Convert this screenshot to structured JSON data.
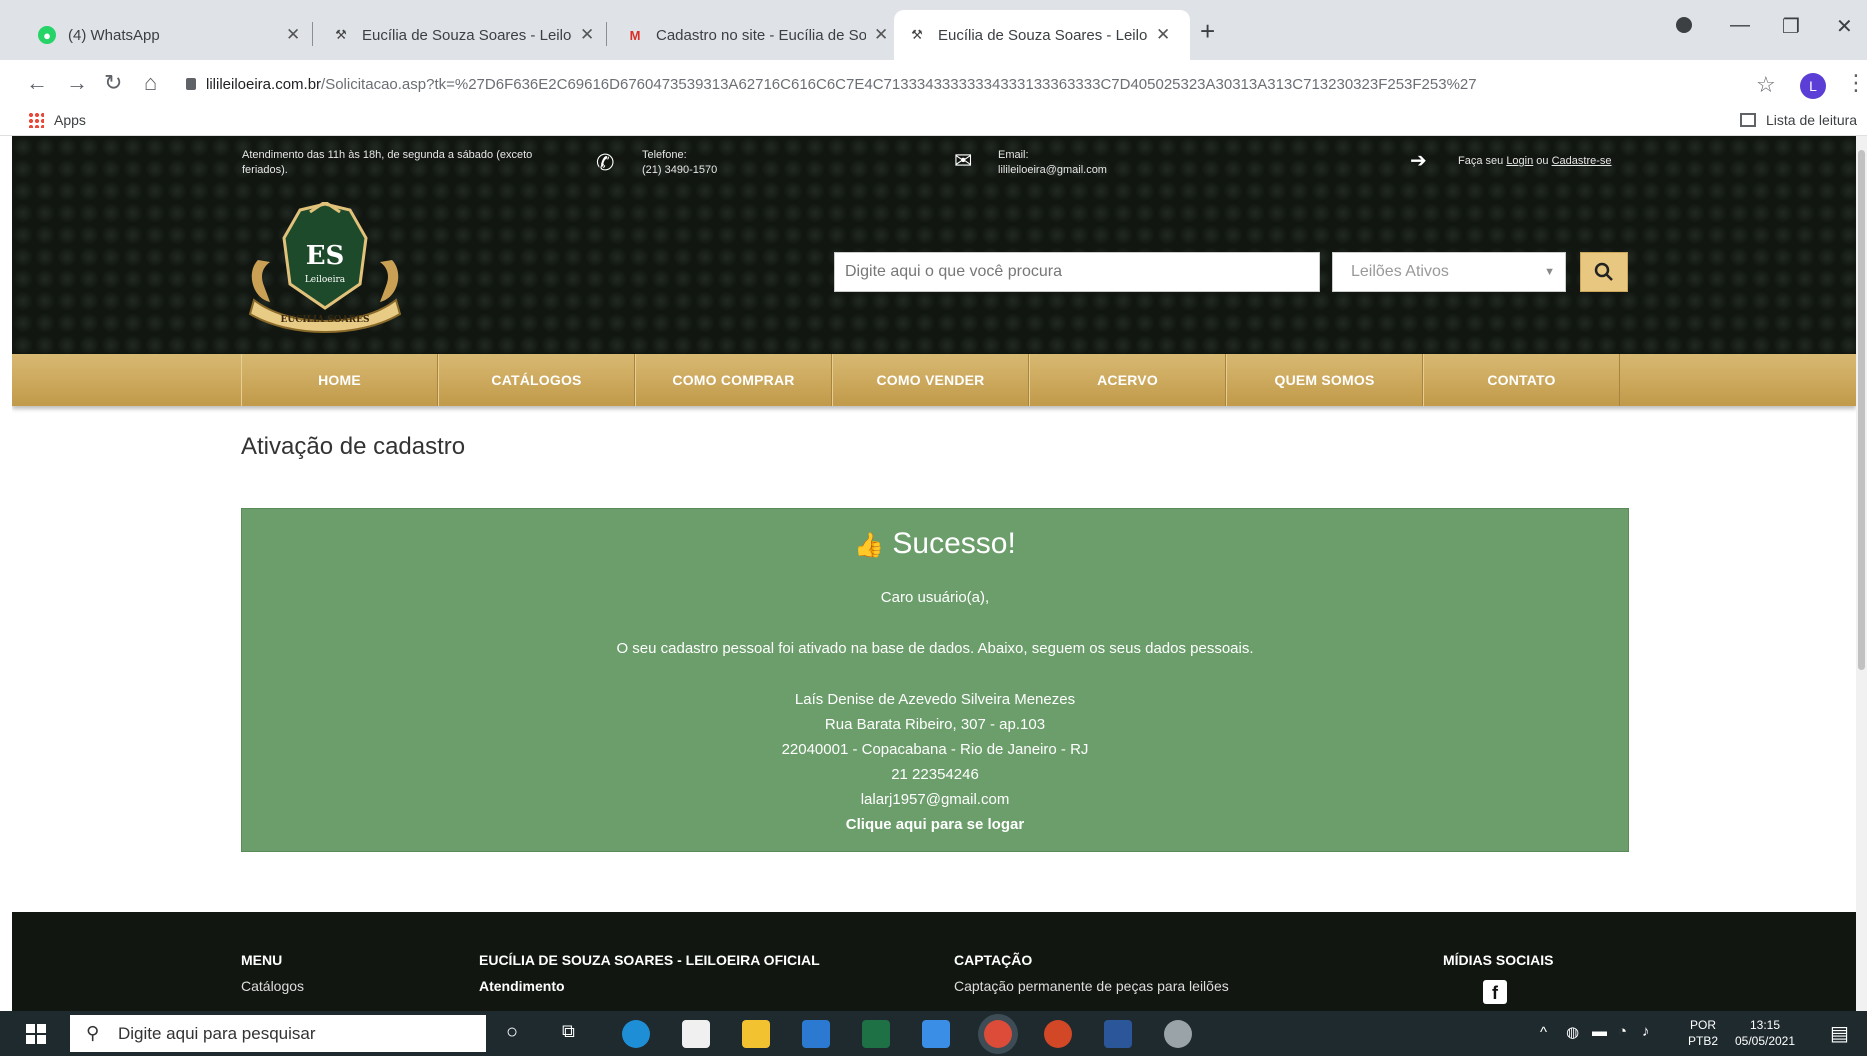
{
  "browser": {
    "tabs": [
      {
        "title": "(4) WhatsApp",
        "icon": "whatsapp-icon",
        "active": false
      },
      {
        "title": "Eucília de Souza Soares - Leiloei",
        "icon": "gavel-icon",
        "active": false
      },
      {
        "title": "Cadastro no site - Eucília de Sou",
        "icon": "gmail-icon",
        "active": false
      },
      {
        "title": "Eucília de Souza Soares - Leiloei",
        "icon": "gavel-icon",
        "active": true
      }
    ],
    "new_tab": "+",
    "url_domain": "lilileiloeira.com.br",
    "url_path": "/Solicitacao.asp?tk=%27D6F636E2C69616D6760473539313A62716C616C6C7E4C71333433333334333133363333C7D405025323A30313A313C713230323F253F253%27",
    "profile_initial": "L",
    "bookmarks": {
      "apps": "Apps",
      "reading_list": "Lista de leitura"
    }
  },
  "site": {
    "header": {
      "hours": "Atendimento das 11h às 18h, de segunda a sábado (exceto feriados).",
      "phone_label": "Telefone:",
      "phone": "(21) 3490-1570",
      "email_label": "Email:",
      "email": "lilileiloeira@gmail.com",
      "login_prefix": "Faça seu",
      "login": "Login",
      "login_or": "ou",
      "signup": "Cadastre-se"
    },
    "logo": {
      "initials": "ES",
      "subtitle": "Leiloeira",
      "ribbon": "EUCILIA SOARES"
    },
    "search": {
      "placeholder": "Digite aqui o que você procura",
      "select_value": "Leilões Ativos"
    },
    "menu": [
      "HOME",
      "CATÁLOGOS",
      "COMO COMPRAR",
      "COMO VENDER",
      "ACERVO",
      "QUEM SOMOS",
      "CONTATO"
    ],
    "page_title": "Ativação de cadastro",
    "alert": {
      "heading": "Sucesso!",
      "greeting": "Caro usuário(a),",
      "message": "O seu cadastro pessoal foi ativado na base de dados. Abaixo, seguem os seus dados pessoais.",
      "name": "Laís Denise de Azevedo Silveira Menezes",
      "address": "Rua Barata Ribeiro, 307 - ap.103",
      "city": "22040001 - Copacabana - Rio de Janeiro - RJ",
      "phone": "21 22354246",
      "email": "lalarj1957@gmail.com",
      "login_link": "Clique aqui para se logar"
    },
    "footer": {
      "menu_title": "MENU",
      "menu_first": "Catálogos",
      "company_title": "EUCÍLIA DE SOUZA SOARES - LEILOEIRA OFICIAL",
      "company_sub": "Atendimento",
      "capture_title": "CAPTAÇÃO",
      "capture_text": "Captação permanente de peças para leilões",
      "social_title": "MÍDIAS SOCIAIS",
      "social_icon": "f"
    }
  },
  "taskbar": {
    "search_placeholder": "Digite aqui para pesquisar",
    "lang": "POR",
    "layout": "PTB2",
    "time": "13:15",
    "date": "05/05/2021"
  },
  "colors": {
    "gold": "#c9a55a",
    "alert_green": "#6b9e6b",
    "dark_bg": "#111611"
  }
}
